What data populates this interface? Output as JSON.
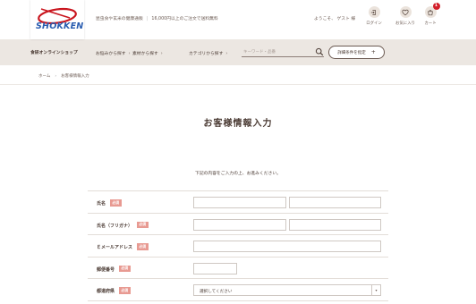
{
  "header": {
    "logo_text": "SHOKKEN",
    "tagline_left": "昆虫食や玄米の健康通販",
    "tagline_right": "16,000円以上のご注文で送料無料",
    "welcome": "ようこそ、 ゲスト 様",
    "icons": [
      {
        "label": "ログイン",
        "icon": "login-icon"
      },
      {
        "label": "お気に入り",
        "icon": "heart-icon"
      },
      {
        "label": "カート",
        "icon": "cart-icon",
        "badge": "1"
      }
    ],
    "badge_color": "#d21f2a"
  },
  "nav": {
    "shop_name": "食研オンラインショップ",
    "links": [
      {
        "label": "お悩みから探す"
      },
      {
        "label": "素材から探す"
      },
      {
        "label": "カテゴリから探す"
      }
    ],
    "search_placeholder": "キーワード・品番",
    "detail_button": "詳細条件を指定",
    "background": "#ece7e2"
  },
  "breadcrumb": {
    "home": "ホーム",
    "current": "お客様情報入力"
  },
  "main": {
    "title": "お客様情報入力",
    "intro": "下記の内容をご入力の上、お進みください。",
    "required_label": "必須",
    "required_color": "#e89a92",
    "fields": [
      {
        "label": "氏名"
      },
      {
        "label": "氏名（フリガナ）"
      },
      {
        "label": "Ｅメールアドレス"
      },
      {
        "label": "郵便番号"
      },
      {
        "label": "都道府県",
        "select_value": "選択してください"
      }
    ]
  }
}
